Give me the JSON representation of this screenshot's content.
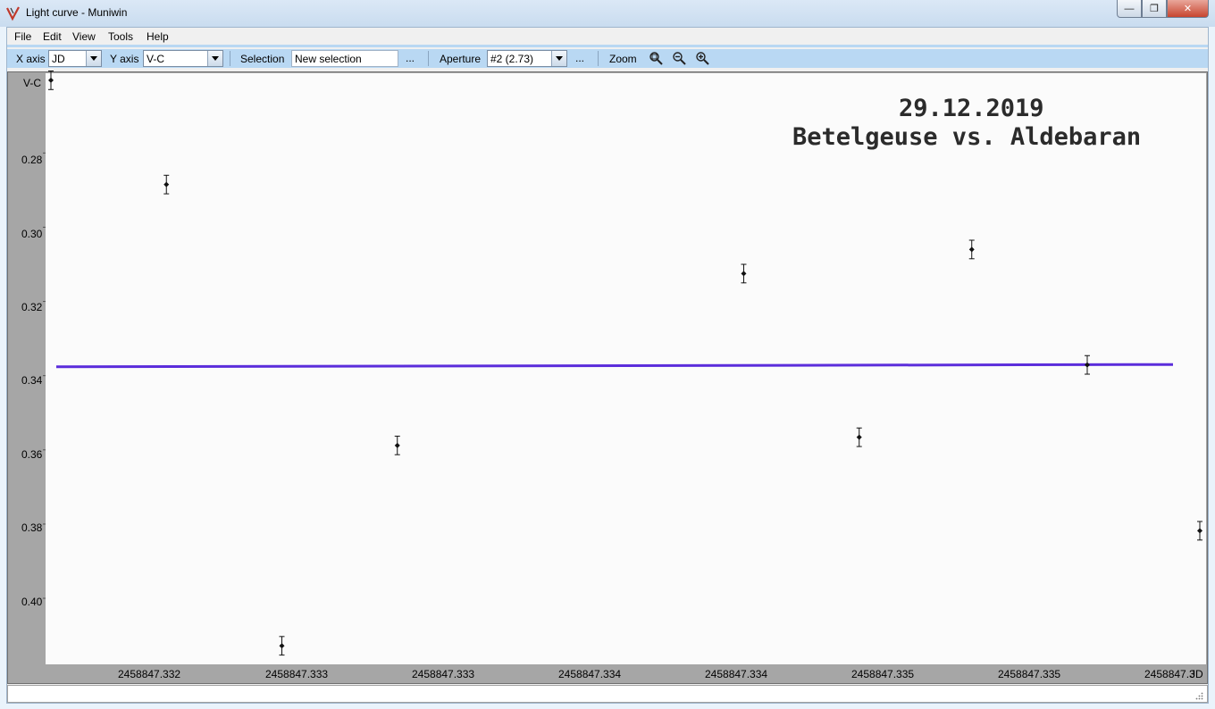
{
  "window": {
    "title": "Light curve - Muniwin",
    "controls": [
      "minimize-icon",
      "maximize-icon",
      "close-icon"
    ]
  },
  "menu": [
    "File",
    "Edit",
    "View",
    "Tools",
    "Help"
  ],
  "toolbar": {
    "x_axis_label": "X axis",
    "x_axis_value": "JD",
    "y_axis_label": "Y axis",
    "y_axis_value": "V-C",
    "selection_label": "Selection",
    "selection_value": "New selection",
    "selection_more": "...",
    "aperture_label": "Aperture",
    "aperture_value": "#2 (2.73)",
    "aperture_more": "...",
    "zoom_label": "Zoom",
    "zoom_icons": [
      "zoom-fit-icon",
      "zoom-out-icon",
      "zoom-in-icon"
    ]
  },
  "chart_data": {
    "type": "scatter",
    "ylabel": "V-C",
    "xlabel": "JD",
    "y_inverted": true,
    "ylim": [
      0.2585,
      0.4178
    ],
    "y_ticks": [
      "0.28",
      "0.30",
      "0.32",
      "0.34",
      "0.36",
      "0.38",
      "0.40"
    ],
    "x_ticks": [
      "2458847.332",
      "2458847.333",
      "2458847.333",
      "2458847.334",
      "2458847.334",
      "2458847.335",
      "2458847.335",
      "2458847.3"
    ],
    "annotation": [
      "29.12.2019",
      "Betelgeuse vs. Aldebaran"
    ],
    "points": [
      {
        "x": 2458847.33151,
        "y": 0.2604,
        "err": 0.0025
      },
      {
        "x": 2458847.33191,
        "y": 0.2885,
        "err": 0.0025
      },
      {
        "x": 2458847.33231,
        "y": 0.4128,
        "err": 0.0025
      },
      {
        "x": 2458847.33271,
        "y": 0.3588,
        "err": 0.0025
      },
      {
        "x": 2458847.33391,
        "y": 0.3125,
        "err": 0.0025
      },
      {
        "x": 2458847.33431,
        "y": 0.3566,
        "err": 0.0025
      },
      {
        "x": 2458847.3347,
        "y": 0.306,
        "err": 0.0025
      },
      {
        "x": 2458847.3351,
        "y": 0.3371,
        "err": 0.0025
      },
      {
        "x": 2458847.33549,
        "y": 0.3818,
        "err": 0.0025
      }
    ],
    "trend_line": {
      "color": "#5b2ddb",
      "y_start": 0.3376,
      "y_end": 0.337
    },
    "grid": false
  }
}
